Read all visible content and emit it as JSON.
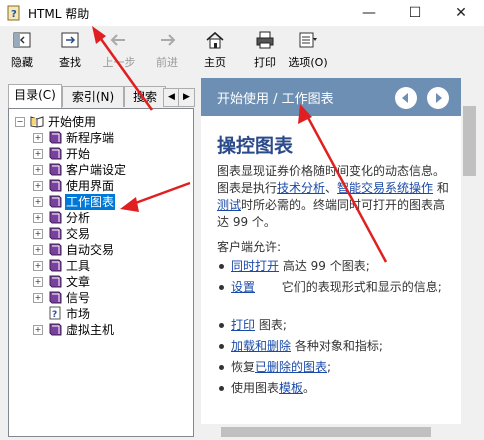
{
  "window": {
    "title": "HTML 帮助",
    "minimize": "—",
    "maximize": "☐",
    "close": "✕"
  },
  "toolbar": [
    {
      "label": "隐藏",
      "icon": "hide-panel-icon",
      "disabled": false
    },
    {
      "label": "查找",
      "icon": "locate-icon",
      "disabled": false
    },
    {
      "label": "上一步",
      "icon": "back-arrow-icon",
      "disabled": true
    },
    {
      "label": "前进",
      "icon": "forward-arrow-icon",
      "disabled": true
    },
    {
      "label": "主页",
      "icon": "home-icon",
      "disabled": false
    },
    {
      "label": "打印",
      "icon": "printer-icon",
      "disabled": false
    },
    {
      "label": "选项(O)",
      "icon": "options-icon",
      "disabled": false
    }
  ],
  "nav_tabs": [
    {
      "label": "目录(C)",
      "active": true
    },
    {
      "label": "索引(N)",
      "active": false
    },
    {
      "label": "搜索",
      "active": false
    }
  ],
  "tree": {
    "root": "开始使用",
    "items": [
      {
        "label": "新程序端",
        "type": "book"
      },
      {
        "label": "开始",
        "type": "book"
      },
      {
        "label": "客户端设定",
        "type": "book"
      },
      {
        "label": "使用界面",
        "type": "book"
      },
      {
        "label": "工作图表",
        "type": "book",
        "selected": true
      },
      {
        "label": "分析",
        "type": "book"
      },
      {
        "label": "交易",
        "type": "book"
      },
      {
        "label": "自动交易",
        "type": "book"
      },
      {
        "label": "工具",
        "type": "book"
      },
      {
        "label": "文章",
        "type": "book"
      },
      {
        "label": "信号",
        "type": "book"
      },
      {
        "label": "市场",
        "type": "page"
      },
      {
        "label": "虚拟主机",
        "type": "book"
      }
    ]
  },
  "topic": {
    "breadcrumb": "开始使用 / 工作图表",
    "heading": "操控图表",
    "intro": {
      "p1": "图表显现证券价格随时间变化的动态信息。图表是执行",
      "link1": "技术分析",
      "p2": "、",
      "link2": "智能交易系统操作",
      "p3": " 和",
      "link3": "测试",
      "p4": "时所必需的。终端同时可打开的图表高达 99 个。"
    },
    "allow_label": "客户端允许:",
    "bullets": [
      {
        "link": "同时打开",
        "text": " 高达 99 个图表;"
      },
      {
        "link": "设置",
        "text": "       它们的表现形式和显示的信息;"
      },
      {
        "link": "打印",
        "text": " 图表;"
      },
      {
        "link": "加载和删除",
        "text": " 各种对象和指标;"
      },
      {
        "pre": "恢复",
        "link": "已删除的图表",
        "text": ";"
      },
      {
        "pre": "使用图表",
        "link": "模板",
        "text": "。"
      }
    ]
  },
  "colors": {
    "accent": "#6d8fb3",
    "selection": "#0078d7",
    "annotation": "#e02020",
    "link": "#1a4aa8",
    "heading": "#2a4a8a"
  }
}
